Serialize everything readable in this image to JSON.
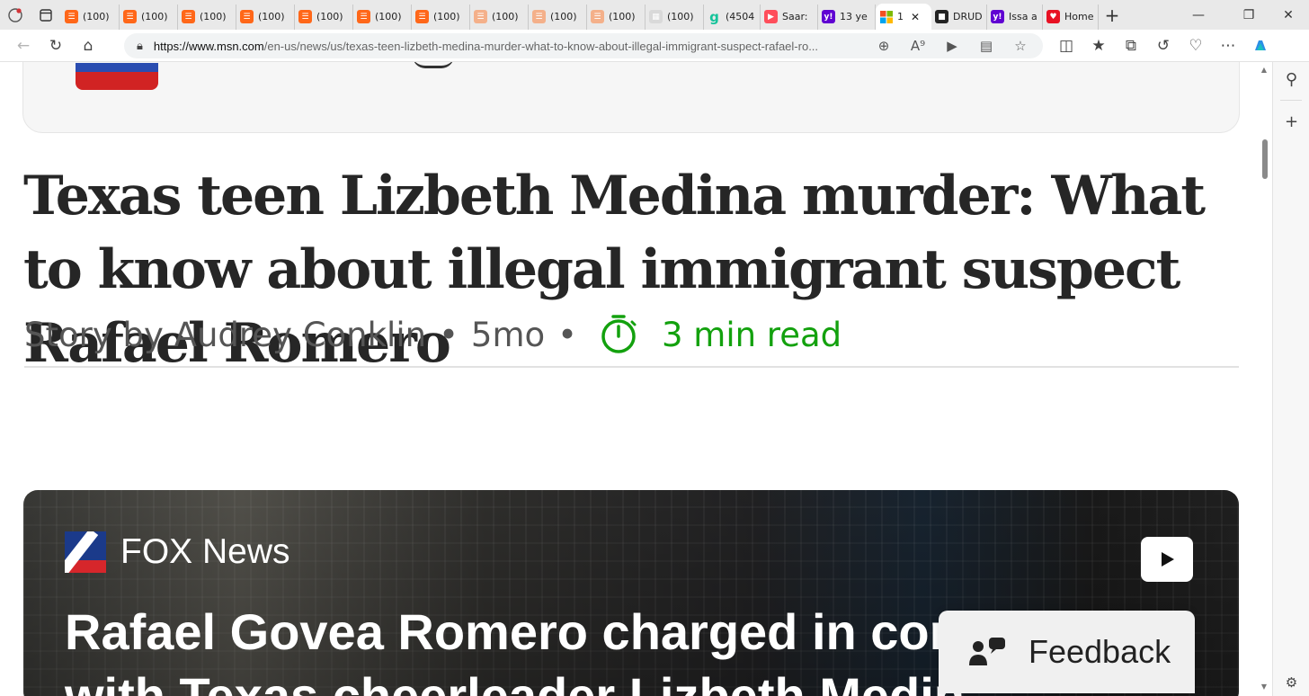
{
  "tabs": [
    {
      "label": "(100)",
      "favicon": "substack-icon",
      "color": "#ff6719"
    },
    {
      "label": "(100)",
      "favicon": "substack-icon",
      "color": "#ff6719"
    },
    {
      "label": "(100)",
      "favicon": "substack-icon",
      "color": "#ff6719"
    },
    {
      "label": "(100)",
      "favicon": "substack-icon",
      "color": "#ff6719"
    },
    {
      "label": "(100)",
      "favicon": "substack-icon",
      "color": "#ff6719"
    },
    {
      "label": "(100)",
      "favicon": "substack-icon",
      "color": "#ff6719"
    },
    {
      "label": "(100)",
      "favicon": "substack-icon",
      "color": "#ff6719"
    },
    {
      "label": "(100)",
      "favicon": "substack-icon",
      "color": "#f4b08a"
    },
    {
      "label": "(100)",
      "favicon": "substack-icon",
      "color": "#f4b08a"
    },
    {
      "label": "(100)",
      "favicon": "substack-icon",
      "color": "#f4b08a"
    },
    {
      "label": "(100)",
      "favicon": "gallery-icon",
      "color": "#d9d9d9"
    },
    {
      "label": "(4504",
      "favicon": "grammarly-icon",
      "color": "#15c39a"
    },
    {
      "label": "Saar:",
      "favicon": "youtube-icon",
      "color": "#ff4e5b"
    },
    {
      "label": "13 ye",
      "favicon": "yahoo-icon",
      "color": "#6001d2"
    },
    {
      "label": "1",
      "favicon": "msn-icon",
      "color": "#ffffff",
      "active": true
    },
    {
      "label": "DRUD",
      "favicon": "drudge-icon",
      "color": "#222222"
    },
    {
      "label": "Issa a",
      "favicon": "yahoo-icon",
      "color": "#6001d2"
    },
    {
      "label": "Home",
      "favicon": "home-icon",
      "color": "#e81123"
    }
  ],
  "address_bar": {
    "url_host": "https://www.msn.com",
    "url_path": "/en-us/news/us/texas-teen-lizbeth-medina-murder-what-to-know-about-illegal-immigrant-suspect-rafael-ro..."
  },
  "article": {
    "headline": "Texas teen Lizbeth Medina murder: What to know about illegal immigrant suspect Rafael Romero",
    "byline": "Story by Audrey Conklin",
    "age": "5mo",
    "separator": "•",
    "read_time": "3 min read",
    "read_time_color": "#13a10e"
  },
  "video": {
    "source": "FOX News",
    "title_line1": "Rafael Govea Romero charged in conn",
    "title_line2": "with Texas cheerleader Lizbeth Medin"
  },
  "feedback": {
    "label": "Feedback"
  }
}
